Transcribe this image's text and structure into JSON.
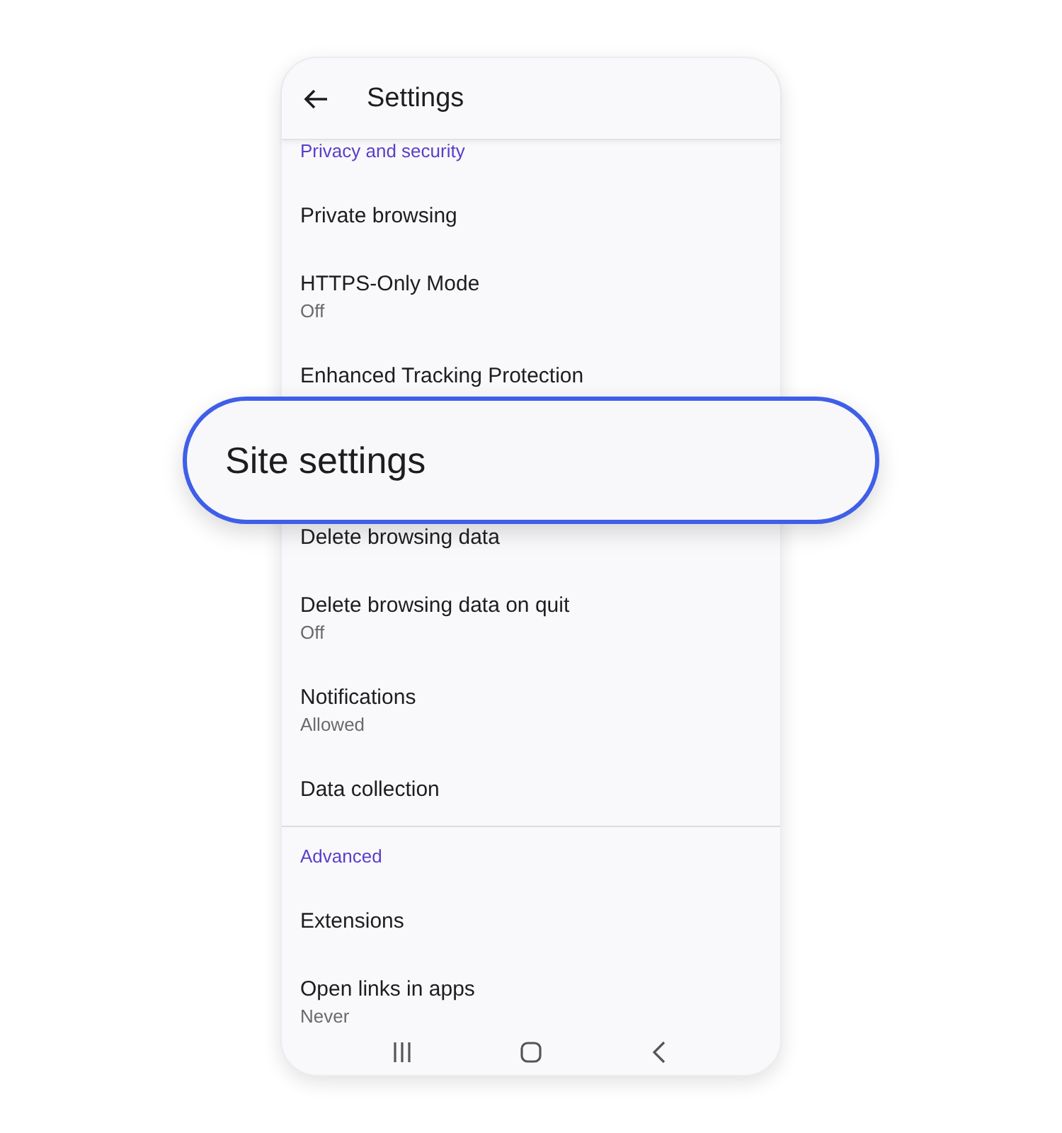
{
  "header": {
    "title": "Settings"
  },
  "sections": [
    {
      "title": "Privacy and security",
      "items": [
        {
          "kind": "row",
          "title": "Private browsing"
        },
        {
          "kind": "row",
          "title": "HTTPS-Only Mode",
          "subtitle": "Off"
        },
        {
          "kind": "row",
          "title": "Enhanced Tracking Protection"
        },
        {
          "kind": "callout",
          "title": "Site settings"
        },
        {
          "kind": "row",
          "title": "Delete browsing data"
        },
        {
          "kind": "row",
          "title": "Delete browsing data on quit",
          "subtitle": "Off"
        },
        {
          "kind": "row",
          "title": "Notifications",
          "subtitle": "Allowed"
        },
        {
          "kind": "row",
          "title": "Data collection"
        }
      ]
    },
    {
      "title": "Advanced",
      "items": [
        {
          "kind": "row",
          "title": "Extensions"
        },
        {
          "kind": "row",
          "title": "Open links in apps",
          "subtitle": "Never"
        }
      ]
    }
  ]
}
